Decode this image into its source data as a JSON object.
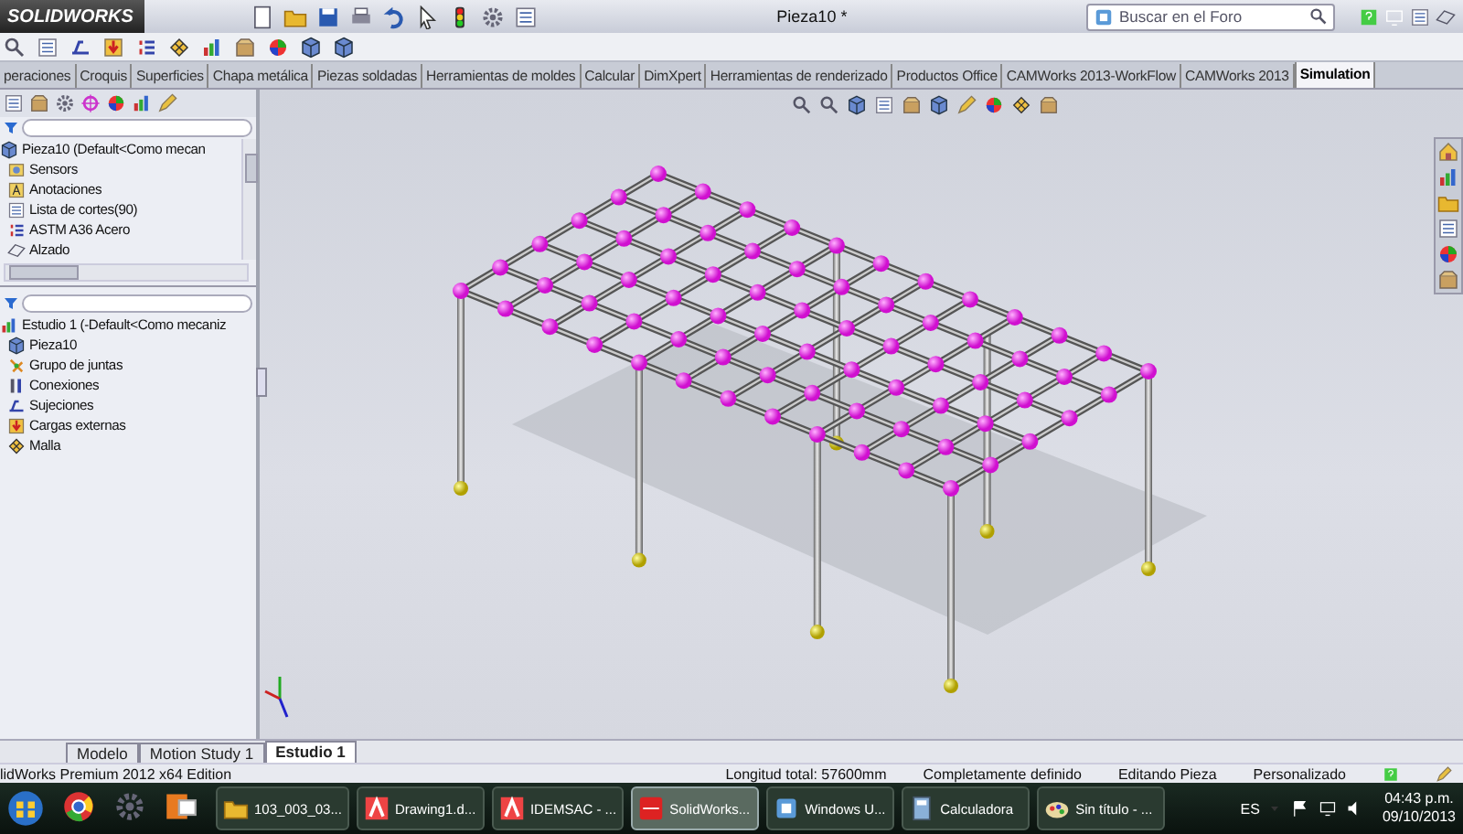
{
  "app": {
    "logo": "SOLIDWORKS",
    "title": "Pieza10 *",
    "search": {
      "placeholder": "Buscar en el Foro"
    }
  },
  "tabs": [
    {
      "label": "peraciones",
      "selected": false
    },
    {
      "label": "Croquis",
      "selected": false
    },
    {
      "label": "Superficies",
      "selected": false
    },
    {
      "label": "Chapa metálica",
      "selected": false
    },
    {
      "label": "Piezas soldadas",
      "selected": false
    },
    {
      "label": "Herramientas de moldes",
      "selected": false
    },
    {
      "label": "Calcular",
      "selected": false
    },
    {
      "label": "DimXpert",
      "selected": false
    },
    {
      "label": "Herramientas de renderizado",
      "selected": false
    },
    {
      "label": "Productos Office",
      "selected": false
    },
    {
      "label": "CAMWorks 2013-WorkFlow",
      "selected": false
    },
    {
      "label": "CAMWorks 2013",
      "selected": false
    },
    {
      "label": "Simulation",
      "selected": true
    }
  ],
  "feature_tree": {
    "label": "Pieza10 (Default<Como mecan",
    "children": [
      {
        "label": "Sensors"
      },
      {
        "label": "Anotaciones"
      },
      {
        "label": "Lista de cortes(90)"
      },
      {
        "label": "ASTM A36 Acero"
      },
      {
        "label": "Alzado"
      }
    ]
  },
  "study_tree": {
    "label": "Estudio 1 (-Default<Como mecaniz",
    "children": [
      {
        "label": "Pieza10"
      },
      {
        "label": "Grupo de juntas"
      },
      {
        "label": "Conexiones"
      },
      {
        "label": "Sujeciones"
      },
      {
        "label": "Cargas externas"
      },
      {
        "label": "Malla"
      }
    ]
  },
  "bottom_tabs": [
    {
      "label": "Modelo",
      "selected": false
    },
    {
      "label": "Motion Study 1",
      "selected": false
    },
    {
      "label": "Estudio 1",
      "selected": true
    }
  ],
  "status_bar": {
    "edition": "lidWorks Premium 2012 x64 Edition",
    "fields": [
      "Longitud total: 57600mm",
      "Completamente definido",
      "Editando Pieza",
      "Personalizado"
    ]
  },
  "taskbar": {
    "tasks": [
      {
        "label": "103_003_03...",
        "selected": false
      },
      {
        "label": "Drawing1.d...",
        "selected": false
      },
      {
        "label": "IDEMSAC - ...",
        "selected": false
      },
      {
        "label": "SolidWorks...",
        "selected": true
      },
      {
        "label": "Windows U...",
        "selected": false
      },
      {
        "label": "Calculadora",
        "selected": false
      },
      {
        "label": "Sin título - ...",
        "selected": false
      }
    ],
    "language": "ES",
    "time": "04:43 p.m.",
    "date": "09/10/2013"
  }
}
